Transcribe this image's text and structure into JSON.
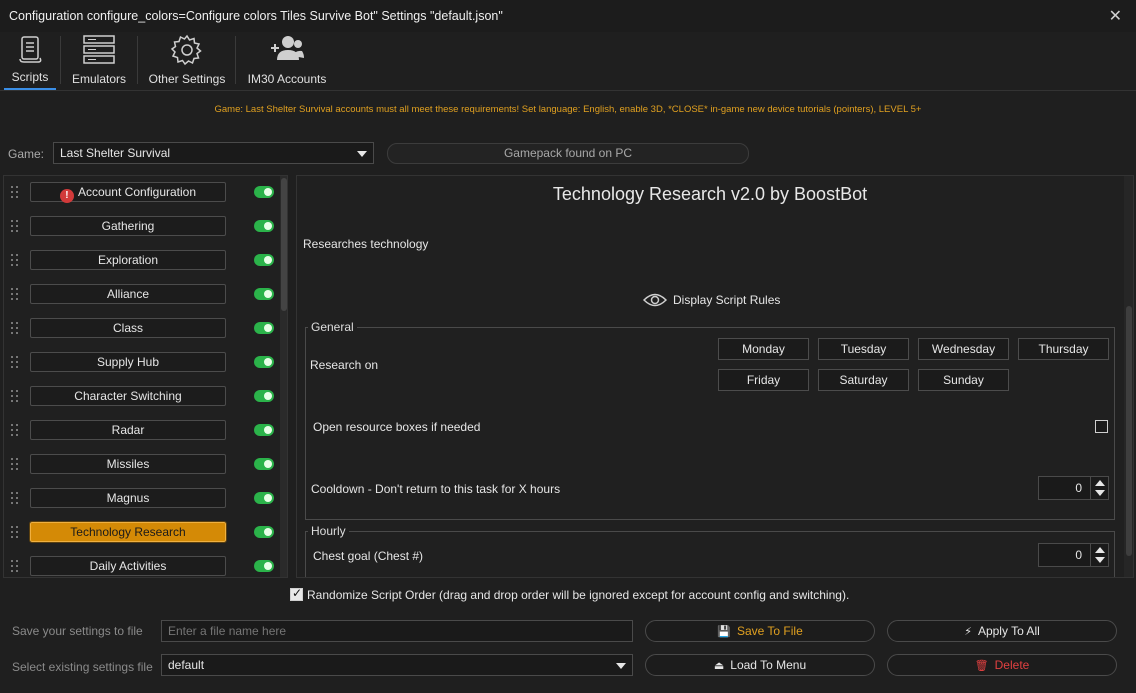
{
  "window": {
    "title": "Configuration configure_colors=Configure colors Tiles Survive Bot\" Settings \"default.json\"",
    "close_glyph": "✕"
  },
  "tabs": [
    {
      "label": "Scripts",
      "icon": "scroll-icon",
      "active": true
    },
    {
      "label": "Emulators",
      "icon": "server-icon"
    },
    {
      "label": "Other Settings",
      "icon": "gear-icon"
    },
    {
      "label": "IM30 Accounts",
      "icon": "users-add-icon"
    }
  ],
  "notice": "Game: Last Shelter Survival accounts must all meet these requirements! Set language: English, enable 3D, *CLOSE* in-game new device tutorials (pointers), LEVEL 5+",
  "game": {
    "label": "Game:",
    "selected": "Last Shelter Survival",
    "gamepack_status": "Gamepack found on PC"
  },
  "scripts": [
    {
      "label": "Account Configuration",
      "warning": true,
      "enabled": true
    },
    {
      "label": "Gathering",
      "enabled": true
    },
    {
      "label": "Exploration",
      "enabled": true
    },
    {
      "label": "Alliance",
      "enabled": true
    },
    {
      "label": "Class",
      "enabled": true
    },
    {
      "label": "Supply Hub",
      "enabled": true
    },
    {
      "label": "Character Switching",
      "enabled": true
    },
    {
      "label": "Radar",
      "enabled": true
    },
    {
      "label": "Missiles",
      "enabled": true
    },
    {
      "label": "Magnus",
      "enabled": true
    },
    {
      "label": "Technology Research",
      "enabled": true,
      "active": true
    },
    {
      "label": "Daily Activities",
      "enabled": true
    }
  ],
  "detail": {
    "title": "Technology Research v2.0 by BoostBot",
    "description": "Researches technology",
    "rules_label": "Display Script Rules",
    "general": {
      "title": "General",
      "research_on_label": "Research on",
      "days": [
        "Monday",
        "Tuesday",
        "Wednesday",
        "Thursday",
        "Friday",
        "Saturday",
        "Sunday"
      ],
      "open_boxes_label": "Open resource boxes if needed",
      "open_boxes_checked": false,
      "cooldown_label": "Cooldown - Don't return to this task for X hours",
      "cooldown_value": "0"
    },
    "hourly": {
      "title": "Hourly",
      "chest_goal_label": "Chest goal (Chest #)",
      "chest_goal_value": "0"
    }
  },
  "bottom": {
    "randomize_label": "Randomize Script Order (drag and drop order will be ignored except for account config and switching).",
    "randomize_checked": true,
    "save_label": "Save your settings to file",
    "file_placeholder": "Enter a file name here",
    "save_button": "Save To File",
    "apply_all_button": "Apply To All",
    "select_label": "Select existing settings file",
    "selected_file": "default",
    "load_button": "Load To Menu",
    "delete_button": "Delete"
  },
  "colors": {
    "accent_active": "#d48a06",
    "toggle_on": "#2bb34a",
    "notice": "#e0a020",
    "delete": "#e04040"
  }
}
